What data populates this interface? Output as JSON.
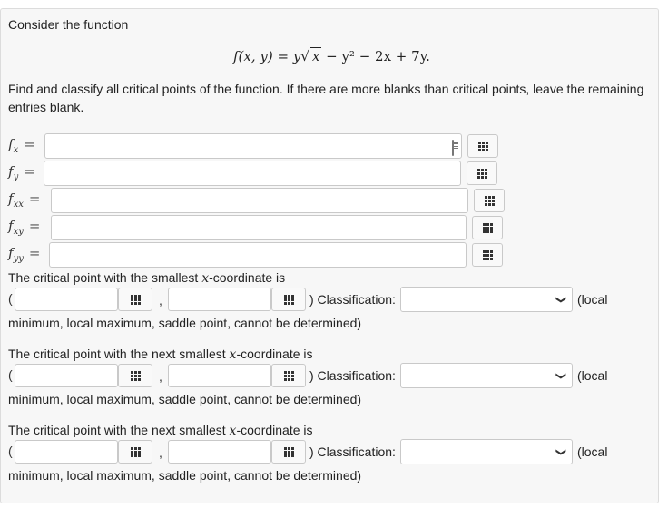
{
  "intro": "Consider the function",
  "formula": {
    "lhs": "f(x, y) = y",
    "sqrt_arg": "x",
    "rest": " − y² − 2x + 7y."
  },
  "instructions": "Find and classify all critical points of the function. If there are more blanks than critical points, leave the remaining entries blank.",
  "partials": [
    {
      "name": "f",
      "sub": "x",
      "value": ""
    },
    {
      "name": "f",
      "sub": "y",
      "value": ""
    },
    {
      "name": "f",
      "sub": "xx",
      "value": ""
    },
    {
      "name": "f",
      "sub": "xy",
      "value": ""
    },
    {
      "name": "f",
      "sub": "yy",
      "value": ""
    }
  ],
  "critical_points": [
    {
      "heading_pre": "The critical point with the smallest ",
      "heading_var": "x",
      "heading_post": "-coordinate is",
      "open_paren": "(",
      "comma": ",",
      "close_text": ") Classification:",
      "classification_value": "",
      "hint_start": "(local",
      "hint_end": "minimum, local maximum, saddle point, cannot be determined)"
    },
    {
      "heading_pre": "The critical point with the next smallest ",
      "heading_var": "x",
      "heading_post": "-coordinate is",
      "open_paren": "(",
      "comma": ",",
      "close_text": ") Classification:",
      "classification_value": "",
      "hint_start": "(local",
      "hint_end": "minimum, local maximum, saddle point, cannot be determined)"
    },
    {
      "heading_pre": "The critical point with the next smallest ",
      "heading_var": "x",
      "heading_post": "-coordinate is",
      "open_paren": "(",
      "comma": ",",
      "close_text": ") Classification:",
      "classification_value": "",
      "hint_start": "(local",
      "hint_end": "minimum, local maximum, saddle point, cannot be determined)"
    }
  ],
  "icons": {
    "keypad": "keypad-grid-icon",
    "calculator": "calculator-icon",
    "dropdown": "chevron-down-icon"
  }
}
